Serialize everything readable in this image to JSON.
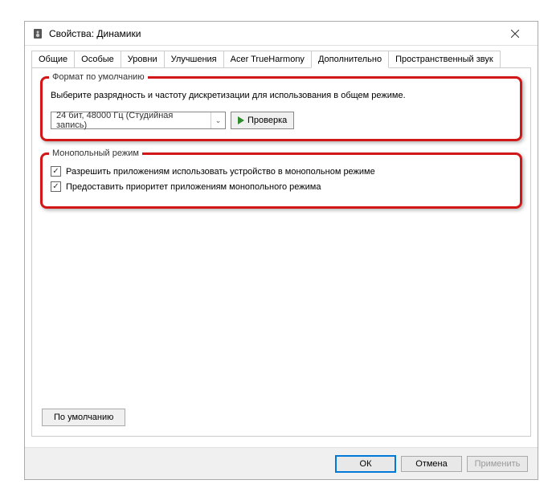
{
  "titlebar": {
    "title": "Свойства: Динамики"
  },
  "tabs": {
    "items": [
      {
        "label": "Общие"
      },
      {
        "label": "Особые"
      },
      {
        "label": "Уровни"
      },
      {
        "label": "Улучшения"
      },
      {
        "label": "Acer TrueHarmony"
      },
      {
        "label": "Дополнительно"
      },
      {
        "label": "Пространственный звук"
      }
    ],
    "active_index": 5
  },
  "default_format": {
    "group_title": "Формат по умолчанию",
    "description": "Выберите разрядность и частоту дискретизации для использования в общем режиме.",
    "selected": "24 бит, 48000 Гц (Студийная запись)",
    "test_label": "Проверка"
  },
  "exclusive_mode": {
    "group_title": "Монопольный режим",
    "allow_label": "Разрешить приложениям использовать устройство в монопольном режиме",
    "allow_checked": true,
    "priority_label": "Предоставить приоритет приложениям монопольного режима",
    "priority_checked": true
  },
  "defaults_button": "По умолчанию",
  "footer": {
    "ok": "ОК",
    "cancel": "Отмена",
    "apply": "Применить"
  }
}
